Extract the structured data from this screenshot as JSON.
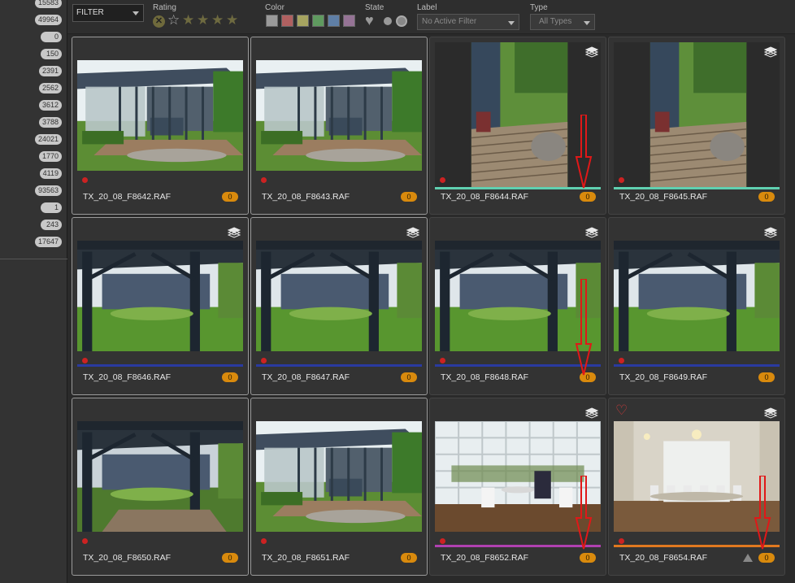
{
  "sidebar": {
    "counts": [
      "15583",
      "49964",
      "0",
      "150",
      "2391",
      "2562",
      "3612",
      "3788",
      "24021",
      "1770",
      "4119",
      "93563",
      "1",
      "243",
      "17647"
    ]
  },
  "filterbar": {
    "filter_label": "FILTER",
    "rating_label": "Rating",
    "color_label": "Color",
    "state_label": "State",
    "label_label": "Label",
    "type_label": "Type",
    "label_placeholder": "No Active Filter",
    "type_value": "All Types",
    "stars": 5,
    "colors": [
      "#9a9a9a",
      "#b06060",
      "#a6a460",
      "#5f9a5f",
      "#5f7fa6",
      "#957395"
    ]
  },
  "thumbnails": [
    {
      "filename": "TX_20_08_F8642.RAF",
      "badge": "0",
      "selected": true,
      "scene": "greenhouse"
    },
    {
      "filename": "TX_20_08_F8643.RAF",
      "badge": "0",
      "selected": true,
      "scene": "greenhouse"
    },
    {
      "filename": "TX_20_08_F8644.RAF",
      "badge": "0",
      "selected": false,
      "scene": "portrait-garden",
      "color_label": "#5fd0b0",
      "stacked": true,
      "arrow": true
    },
    {
      "filename": "TX_20_08_F8645.RAF",
      "badge": "0",
      "selected": false,
      "scene": "portrait-garden",
      "color_label": "#5fd0b0",
      "stacked": true
    },
    {
      "filename": "TX_20_08_F8646.RAF",
      "badge": "0",
      "selected": true,
      "scene": "pergola",
      "color_label": "#2a3aa0",
      "stacked": true
    },
    {
      "filename": "TX_20_08_F8647.RAF",
      "badge": "0",
      "selected": true,
      "scene": "pergola",
      "color_label": "#2a3aa0",
      "stacked": true
    },
    {
      "filename": "TX_20_08_F8648.RAF",
      "badge": "0",
      "selected": false,
      "scene": "pergola",
      "color_label": "#2a3aa0",
      "stacked": true,
      "arrow": true
    },
    {
      "filename": "TX_20_08_F8649.RAF",
      "badge": "0",
      "selected": false,
      "scene": "pergola",
      "color_label": "#2a3aa0",
      "stacked": true
    },
    {
      "filename": "TX_20_08_F8650.RAF",
      "badge": "0",
      "selected": true,
      "scene": "pergola-dark"
    },
    {
      "filename": "TX_20_08_F8651.RAF",
      "badge": "0",
      "selected": true,
      "scene": "greenhouse"
    },
    {
      "filename": "TX_20_08_F8652.RAF",
      "badge": "0",
      "selected": false,
      "scene": "conservatory",
      "color_label": "#b040b0",
      "stacked": true,
      "arrow": true
    },
    {
      "filename": "TX_20_08_F8654.RAF",
      "badge": "0",
      "selected": false,
      "scene": "hall",
      "color_label": "#e07820",
      "stacked": true,
      "heart": true,
      "warning": true,
      "arrow": true
    }
  ]
}
